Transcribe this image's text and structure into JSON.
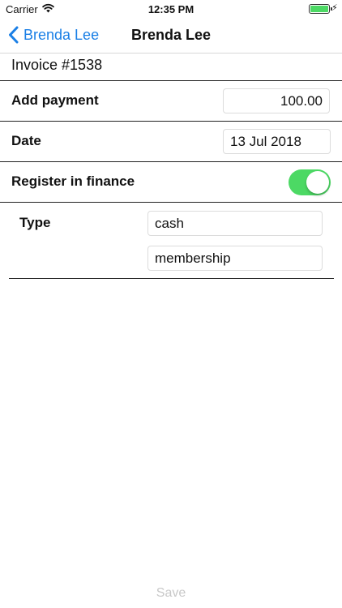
{
  "status_bar": {
    "carrier": "Carrier",
    "time": "12:35 PM",
    "battery_icon": "battery-full-icon",
    "charging_icon": "bolt-icon",
    "wifi_icon": "wifi-icon"
  },
  "nav": {
    "back_label": "Brenda Lee",
    "title": "Brenda Lee",
    "back_icon": "chevron-left-icon"
  },
  "invoice": {
    "label": "Invoice #1538"
  },
  "form": {
    "payment_label": "Add payment",
    "payment_value": "100.00",
    "date_label": "Date",
    "date_value": "13 Jul 2018",
    "finance_label": "Register in finance",
    "finance_enabled": true,
    "type_label": "Type",
    "type_values": [
      "cash",
      "membership"
    ]
  },
  "footer": {
    "save_label": "Save"
  },
  "colors": {
    "accent": "#1a7fe6",
    "toggle_on": "#4cd964",
    "disabled_text": "#c8c8c8"
  }
}
